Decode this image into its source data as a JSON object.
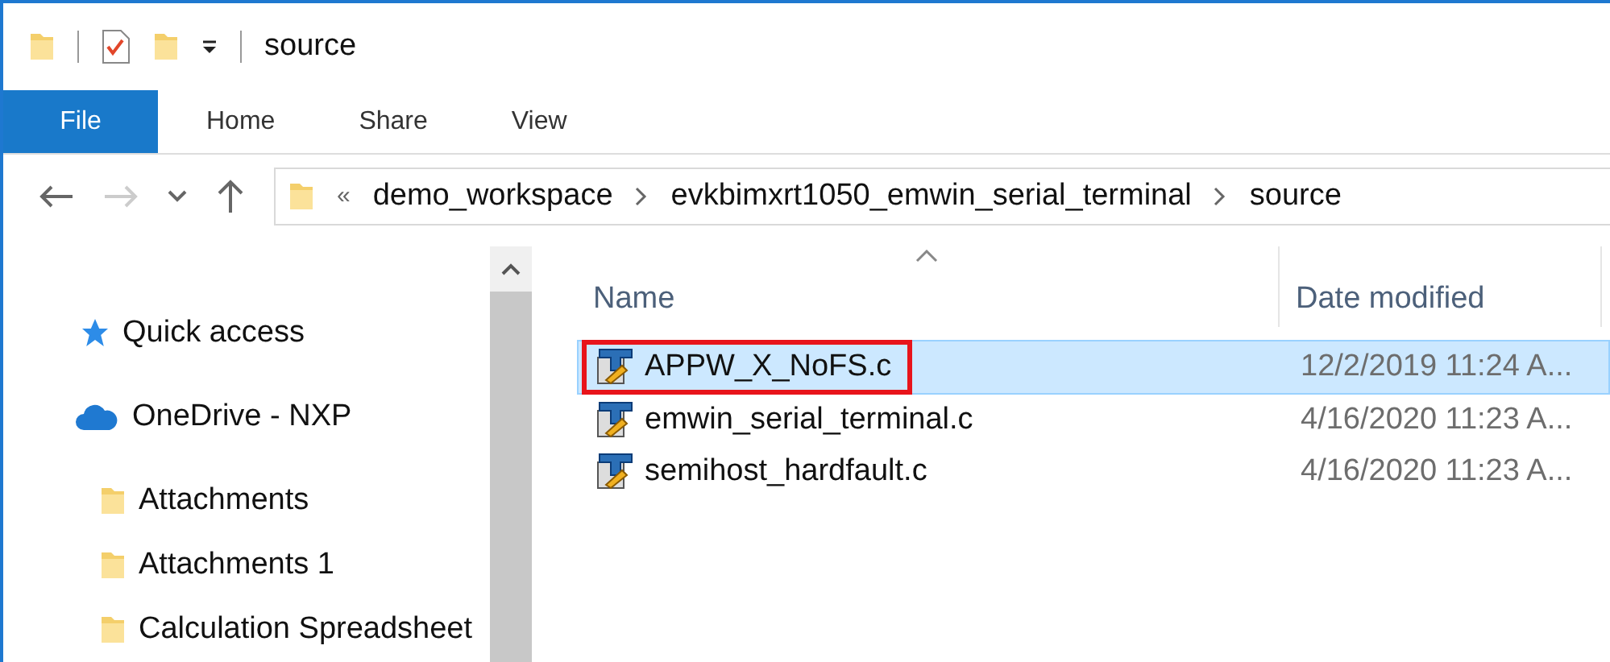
{
  "window": {
    "title": "source"
  },
  "ribbon": {
    "tabs": [
      {
        "label": "File",
        "selected": true
      },
      {
        "label": "Home",
        "selected": false
      },
      {
        "label": "Share",
        "selected": false
      },
      {
        "label": "View",
        "selected": false
      }
    ]
  },
  "address_bar": {
    "overflow": "«",
    "path": [
      {
        "label": "demo_workspace"
      },
      {
        "label": "evkbimxrt1050_emwin_serial_terminal"
      },
      {
        "label": "source"
      }
    ]
  },
  "sidebar": {
    "items": [
      {
        "label": "Quick access",
        "kind": "quick"
      },
      {
        "label": "OneDrive - NXP",
        "kind": "cloud"
      },
      {
        "label": "Attachments",
        "kind": "folder"
      },
      {
        "label": "Attachments 1",
        "kind": "folder"
      },
      {
        "label": "Calculation Spreadsheet",
        "kind": "folder"
      }
    ]
  },
  "file_list": {
    "columns": [
      "Name",
      "Date modified"
    ],
    "rows": [
      {
        "name": "APPW_X_NoFS.c",
        "date": "12/2/2019 11:24 A...",
        "selected": true,
        "outlined": true
      },
      {
        "name": "emwin_serial_terminal.c",
        "date": "4/16/2020 11:23 A...",
        "selected": false,
        "outlined": false
      },
      {
        "name": "semihost_hardfault.c",
        "date": "4/16/2020 11:23 A...",
        "selected": false,
        "outlined": false
      }
    ]
  }
}
